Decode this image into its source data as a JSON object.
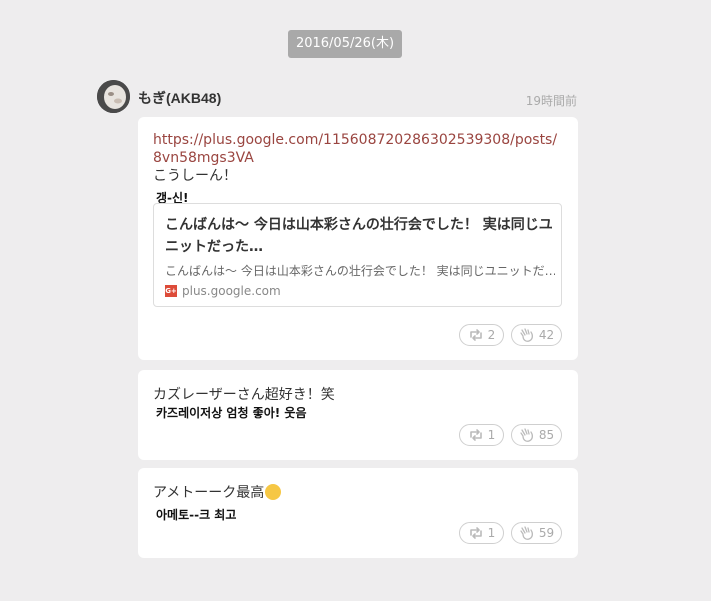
{
  "date_label": "2016/05/26(木)",
  "author": {
    "name": "もぎ(AKB48)",
    "time": "19時間前"
  },
  "posts": [
    {
      "link": "https://plus.google.com/115608720286302539308/posts/8vn58mgs3VA",
      "text_ja": "こうしーん！",
      "text_ko": "갱-신!",
      "preview": {
        "title": "こんばんは〜 今日は山本彩さんの壮行会でした！ 実は同じユニットだった…",
        "description": "こんばんは〜 今日は山本彩さんの壮行会でした！ 実は同じユニットだ…",
        "source": "plus.google.com",
        "source_icon": "G+"
      },
      "retweet_count": "2",
      "like_count": "42"
    },
    {
      "text_ja": "カズレーザーさん超好き！笑",
      "text_ko": "카즈레이저상 엄청 좋아! 웃음",
      "retweet_count": "1",
      "like_count": "85"
    },
    {
      "text_ja": "アメトーーク最高",
      "text_ko": "아메토--크 최고",
      "retweet_count": "1",
      "like_count": "59"
    }
  ]
}
